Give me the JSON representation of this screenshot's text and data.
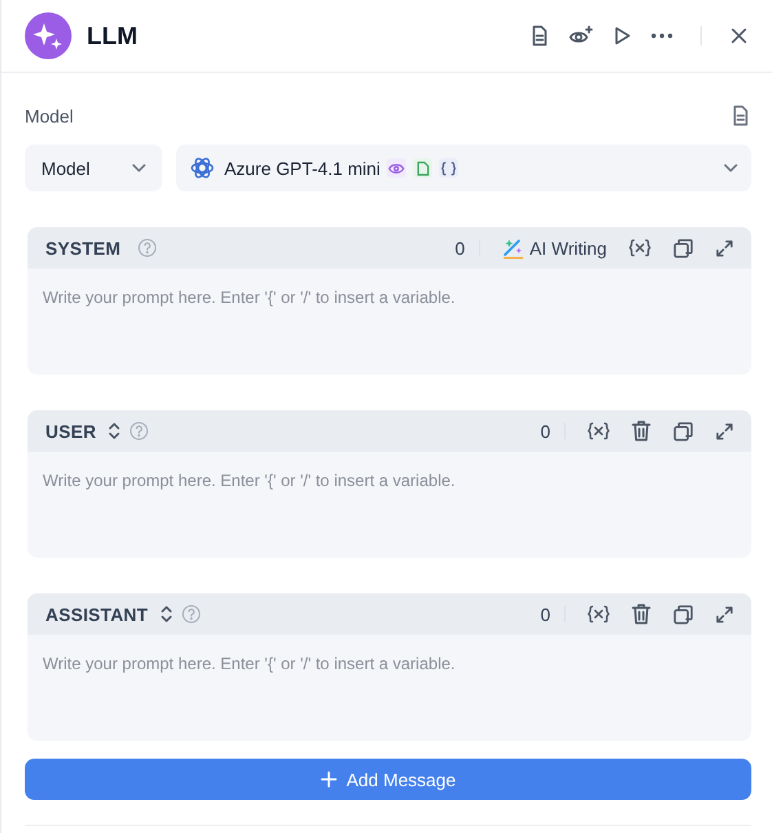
{
  "panel": {
    "title": "LLM"
  },
  "model_section": {
    "label": "Model",
    "type_select": {
      "value": "Model"
    },
    "model_select": {
      "value": "Azure GPT-4.1 mini"
    }
  },
  "messages": [
    {
      "kind": "system",
      "role": "SYSTEM",
      "count": "0",
      "ai_writing": "AI Writing",
      "placeholder": "Write your prompt here. Enter '{' or '/' to insert a variable."
    },
    {
      "kind": "turn",
      "role": "USER",
      "count": "0",
      "placeholder": "Write your prompt here. Enter '{' or '/' to insert a variable."
    },
    {
      "kind": "turn",
      "role": "ASSISTANT",
      "count": "0",
      "placeholder": "Write your prompt here. Enter '{' or '/' to insert a variable."
    }
  ],
  "add_button": {
    "label": "Add Message"
  }
}
